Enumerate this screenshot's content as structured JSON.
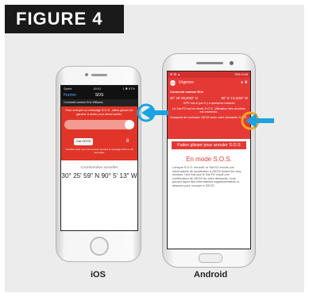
{
  "figure": {
    "label": "FIGURE 4"
  },
  "ios": {
    "caption": "iOS",
    "status_left": "Sprint",
    "status_time": "18:01",
    "status_right": "1 ✱ 97%",
    "nav_close": "Fermer",
    "nav_title": "SOS",
    "connected": "Connecté comme Eric Williams",
    "message": "Pour envoyer un message S.O.S., faites glisser de gauche à droite pour déverrouiller.",
    "call_button": "Call GEOS",
    "countdown": "8",
    "note": "*Veuillez noter que vous pouvez annuler le message SOS en 15 secondes",
    "coord_label": "Coordonnées actuelles",
    "coords": "30° 25' 59\" N  90° 5' 13\" W"
  },
  "android": {
    "caption": "Android",
    "status_right": "76% 6:58",
    "bar_title": "Urgence",
    "sos_badge": "SOS",
    "connected": "Connecté comme Eric",
    "lat": "30° 25' 59,2002'' N",
    "lon": "90° 5' 13,1104'' W",
    "gps": "GPS mis à jour il y a quelques instants",
    "sat_mode": "Le Sat-Fi2 est en mode S.O.S. Utilisation des données est restreinte.",
    "contact": "Essayant de contacter GEOS avec votre demande S.O.S.",
    "slider": "Faites glisser pour annuler S.O.S",
    "mode": "En mode S.O.S.",
    "desc": "Lorsque S.O.S. est actif, le Sat-Fi2 envoie vos informations de localisation à GEOS toutes les cinq minutes. Une fois que le Sat-Fi2 reçoit une confirmation de GEOS de votre demande, vous pouvez taper des informations supplémentaires ci-dessous pour envoyer à GEOS."
  },
  "colors": {
    "accent_red": "#e53935",
    "arrow_blue": "#1aa3e0",
    "knob_orange": "#f5a623"
  }
}
